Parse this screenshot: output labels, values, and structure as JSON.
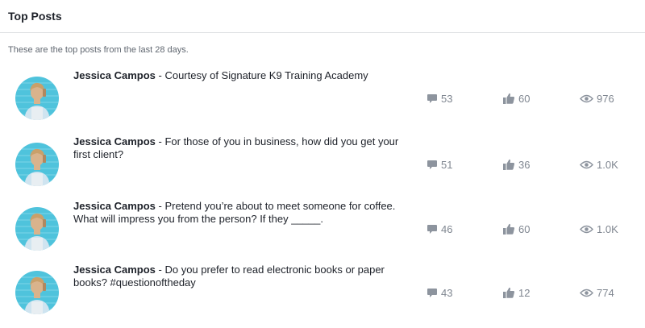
{
  "header": {
    "title": "Top Posts"
  },
  "subtitle": "These are the top posts from the last 28 days.",
  "icons": {
    "comment": "comment-bubble-icon",
    "like": "thumbs-up-icon",
    "views": "eye-icon"
  },
  "colors": {
    "stat_icon": "#8d949e",
    "stat_text": "#7f8690",
    "avatar_bg": "#4fc3dc"
  },
  "posts": [
    {
      "author": "Jessica Campos",
      "text": " - Courtesy of Signature K9 Training Academy",
      "comments": "53",
      "likes": "60",
      "views": "976"
    },
    {
      "author": "Jessica Campos",
      "text": " - For those of you in business, how did you get your first client?",
      "comments": "51",
      "likes": "36",
      "views": "1.0K"
    },
    {
      "author": "Jessica Campos",
      "text": " - Pretend you’re about to meet someone for coffee. What will impress you from the person? If they _____.",
      "comments": "46",
      "likes": "60",
      "views": "1.0K"
    },
    {
      "author": "Jessica Campos",
      "text": " - Do you prefer to read electronic books or paper books? #questionoftheday",
      "comments": "43",
      "likes": "12",
      "views": "774"
    }
  ]
}
